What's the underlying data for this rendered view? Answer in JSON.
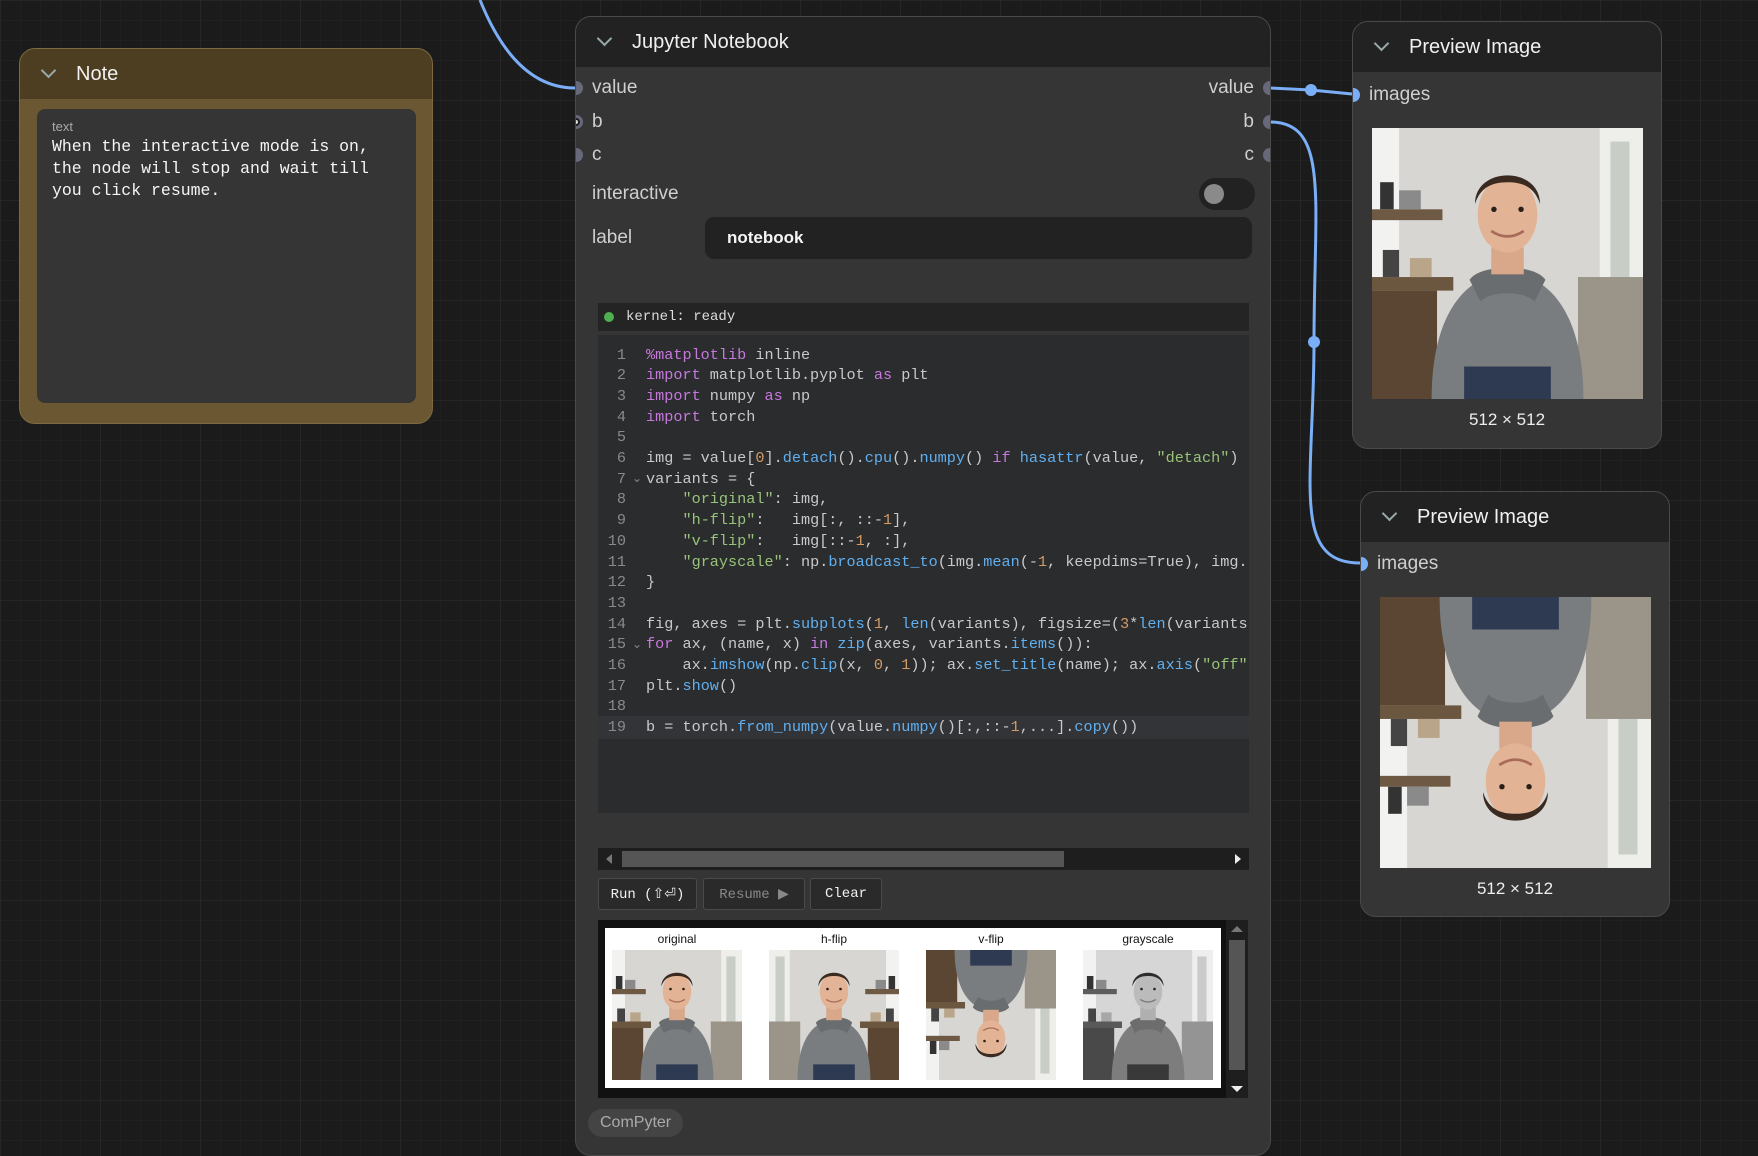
{
  "note": {
    "title": "Note",
    "field_label": "text",
    "text": "When the interactive mode is on,\nthe node will stop and wait till\nyou click resume."
  },
  "jupyter": {
    "title": "Jupyter Notebook",
    "inputs": [
      "value",
      "b",
      "c"
    ],
    "outputs": [
      "value",
      "b",
      "c"
    ],
    "interactive_label": "interactive",
    "interactive_on": false,
    "label_label": "label",
    "label_value": "notebook",
    "kernel_status": "kernel: ready",
    "code_lines": [
      "%matplotlib inline",
      "import matplotlib.pyplot as plt",
      "import numpy as np",
      "import torch",
      "",
      "img = value[0].detach().cpu().numpy() if hasattr(value, \"detach\")",
      "variants = {",
      "    \"original\": img,",
      "    \"h-flip\":   img[:, ::-1],",
      "    \"v-flip\":   img[::-1, :],",
      "    \"grayscale\": np.broadcast_to(img.mean(-1, keepdims=True), img.",
      "}",
      "",
      "fig, axes = plt.subplots(1, len(variants), figsize=(3*len(variants",
      "for ax, (name, x) in zip(axes, variants.items()):",
      "    ax.imshow(np.clip(x, 0, 1)); ax.set_title(name); ax.axis(\"off\"",
      "plt.show()",
      "",
      "b = torch.from_numpy(value.numpy()[:,::-1,...].copy())"
    ],
    "buttons": {
      "run": "Run (⇧⏎)",
      "resume": "Resume ▶",
      "clear": "Clear"
    },
    "output_titles": [
      "original",
      "h-flip",
      "v-flip",
      "grayscale"
    ],
    "badge": "ComPyter"
  },
  "preview1": {
    "title": "Preview Image",
    "input": "images",
    "dims": "512 × 512"
  },
  "preview2": {
    "title": "Preview Image",
    "input": "images",
    "dims": "512 × 512"
  },
  "colors": {
    "link": "#7aaef7",
    "slot": "#67697b",
    "kernel_ready": "#4caf50"
  }
}
